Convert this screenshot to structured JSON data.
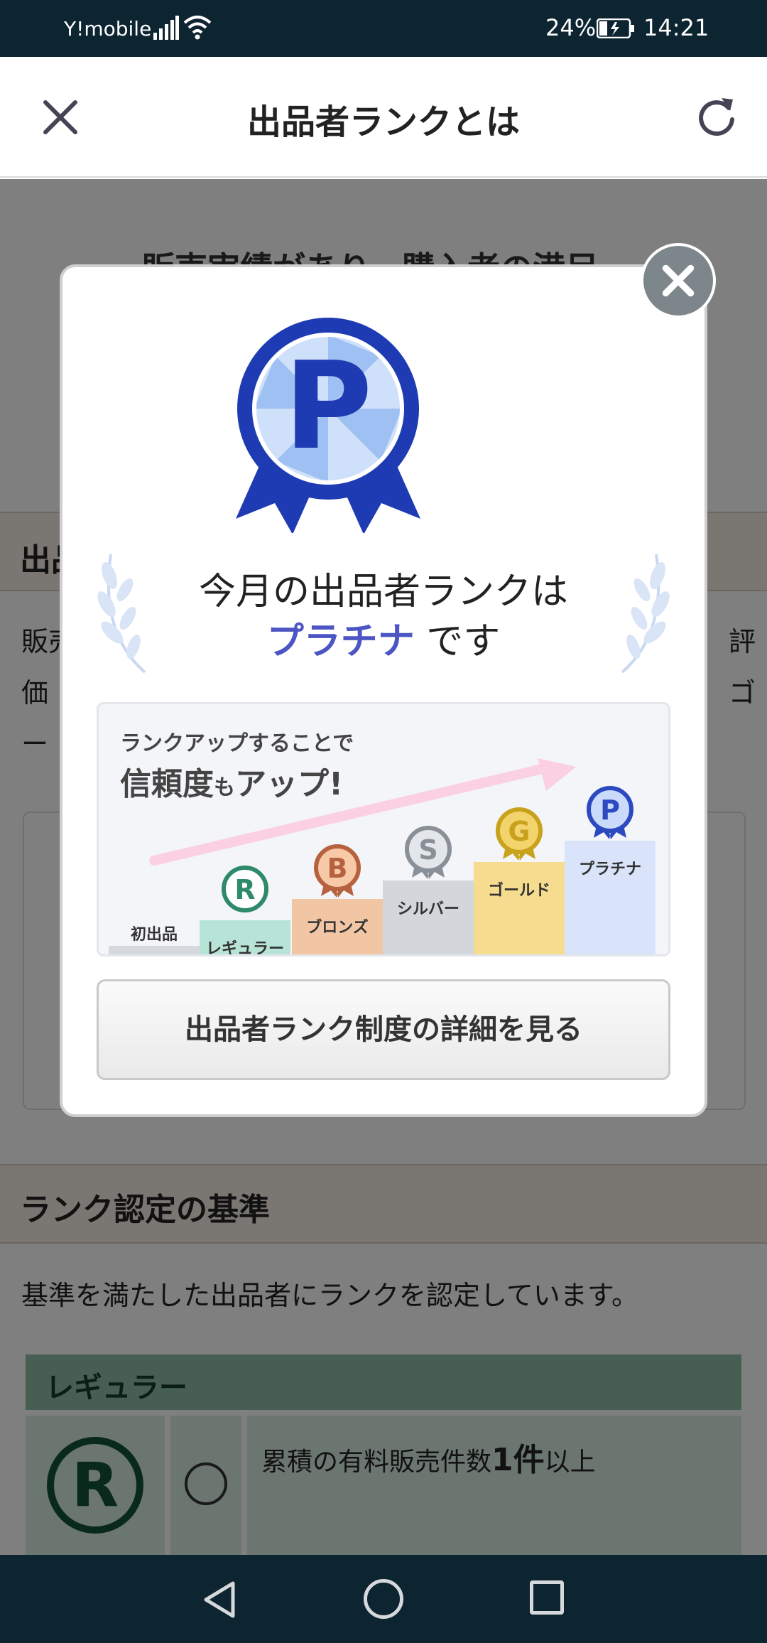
{
  "status_bar": {
    "carrier": "Y!mobile",
    "battery": "24%",
    "time": "14:21"
  },
  "header": {
    "title": "出品者ランクとは"
  },
  "background": {
    "headline": "販売実績があり、購入者の満足",
    "section1": "出品",
    "para1": "販売",
    "para1_end": "評",
    "para2": "価",
    "para2_end": "ゴ",
    "para3": "ー",
    "section2": "ランク認定の基準",
    "para4": "基準を満たした出品者にランクを認定しています。",
    "rank_table": {
      "rank": "レギュラー",
      "icon_letter": "R",
      "requirement_prefix": "累積の有料販売件数",
      "requirement_value": "1件",
      "requirement_suffix": "以上"
    }
  },
  "modal": {
    "medal_letter": "P",
    "line1": "今月の出品者ランクは",
    "rank_name": "プラチナ",
    "line2_suffix": "です",
    "banner": {
      "line1": "ランクアップすることで",
      "line2_main": "信頼度",
      "line2_small": "も",
      "line2_end": "アップ!",
      "steps": [
        {
          "label": "初出品",
          "letter": "",
          "color": "#d5d8dc"
        },
        {
          "label": "レギュラー",
          "letter": "R",
          "color": "#b7e4d6"
        },
        {
          "label": "ブロンズ",
          "letter": "B",
          "color": "#f2c6a5"
        },
        {
          "label": "シルバー",
          "letter": "S",
          "color": "#d3d6db"
        },
        {
          "label": "ゴールド",
          "letter": "G",
          "color": "#f5dc8f"
        },
        {
          "label": "プラチナ",
          "letter": "P",
          "color": "#d9e4fb"
        }
      ]
    },
    "detail_button": "出品者ランク制度の詳細を見る"
  }
}
